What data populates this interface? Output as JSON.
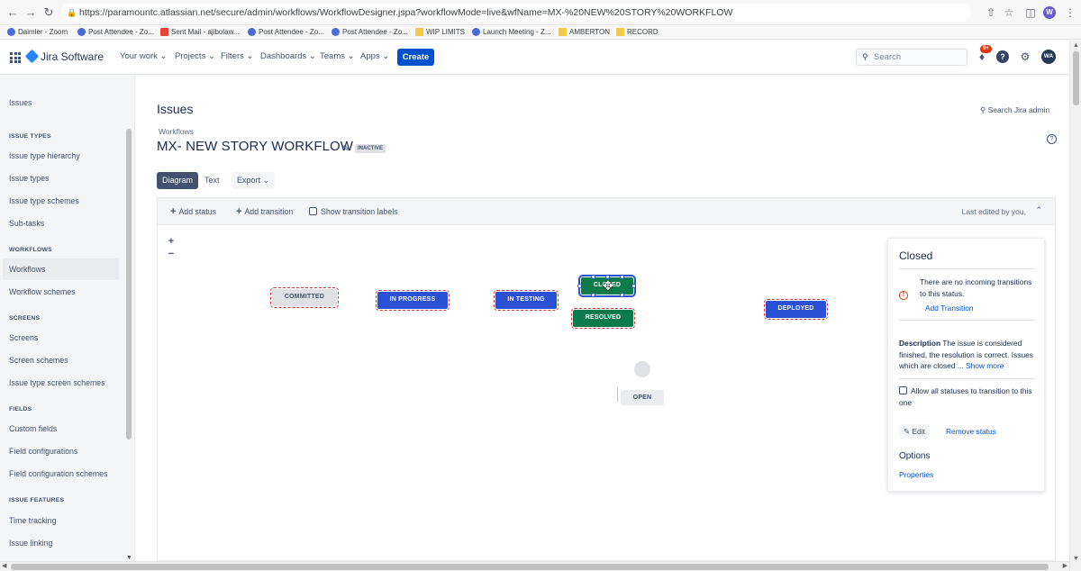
{
  "browser": {
    "url": "https://paramountc.atlassian.net/secure/admin/workflows/WorkflowDesigner.jspa?workflowMode=live&wfName=MX-%20NEW%20STORY%20WORKFLOW",
    "profile_initial": "W",
    "bookmarks": [
      {
        "label": "Daimler - Zoom",
        "icon": "zoom-icon"
      },
      {
        "label": "Post Attendee - Zo...",
        "icon": "zoom-icon"
      },
      {
        "label": "Sent Mail - ajibolaw...",
        "icon": "gmail-icon"
      },
      {
        "label": "Post Attendee - Zo...",
        "icon": "zoom-icon"
      },
      {
        "label": "Post Attendee - Zo...",
        "icon": "zoom-icon"
      },
      {
        "label": "WIP LIMITS",
        "icon": "folder-icon"
      },
      {
        "label": "Launch Meeting - Z...",
        "icon": "zoom-icon"
      },
      {
        "label": "AMBERTON",
        "icon": "folder-icon"
      },
      {
        "label": "RECORD",
        "icon": "folder-icon"
      }
    ]
  },
  "topnav": {
    "product": "Jira Software",
    "items": [
      "Your work",
      "Projects",
      "Filters",
      "Dashboards",
      "Teams",
      "Apps"
    ],
    "create_label": "Create",
    "search_placeholder": "Search",
    "notifications_badge": "9+",
    "help_label": "?",
    "avatar_initials": "WA"
  },
  "sidebar": {
    "top_item": "Issues",
    "sections": [
      {
        "heading": "ISSUE TYPES",
        "items": [
          "Issue type hierarchy",
          "Issue types",
          "Issue type schemes",
          "Sub-tasks"
        ]
      },
      {
        "heading": "WORKFLOWS",
        "items": [
          "Workflows",
          "Workflow schemes"
        ]
      },
      {
        "heading": "SCREENS",
        "items": [
          "Screens",
          "Screen schemes",
          "Issue type screen schemes"
        ]
      },
      {
        "heading": "FIELDS",
        "items": [
          "Custom fields",
          "Field configurations",
          "Field configuration schemes"
        ]
      },
      {
        "heading": "ISSUE FEATURES",
        "items": [
          "Time tracking",
          "Issue linking"
        ]
      }
    ],
    "selected": "Workflows"
  },
  "main": {
    "page_title": "Issues",
    "search_admin": "Search Jira admin",
    "breadcrumb": "Workflows",
    "workflow_title": "MX- NEW STORY WORKFLOW",
    "status_lozenge": "INACTIVE",
    "view_tabs": [
      "Diagram",
      "Text"
    ],
    "export_label": "Export",
    "toolbar": {
      "add_status": "Add status",
      "add_transition": "Add transition",
      "show_labels": "Show transition labels",
      "last_edited": "Last edited by you,"
    },
    "zoom_in": "+",
    "zoom_out": "−"
  },
  "diagram": {
    "statuses": [
      {
        "label": "COMMITTED",
        "style": "grey"
      },
      {
        "label": "IN PROGRESS",
        "style": "blue"
      },
      {
        "label": "IN TESTING",
        "style": "blue"
      },
      {
        "label": "CLOSED",
        "style": "green",
        "selected": true
      },
      {
        "label": "RESOLVED",
        "style": "green"
      },
      {
        "label": "DEPLOYED",
        "style": "blue"
      },
      {
        "label": "OPEN",
        "style": "grey-plain"
      }
    ]
  },
  "panel": {
    "title": "Closed",
    "warning_text": "There are no incoming transitions to this status.",
    "add_transition": "Add Transition",
    "description_label": "Description",
    "description_text": "The issue is considered finished, the resolution is correct. Issues which are closed",
    "ellipsis": "...",
    "show_more": "Show more",
    "allow_all": "Allow all statuses to transition to this one",
    "edit_label": "Edit",
    "remove_status": "Remove status",
    "options_title": "Options",
    "properties": "Properties"
  }
}
